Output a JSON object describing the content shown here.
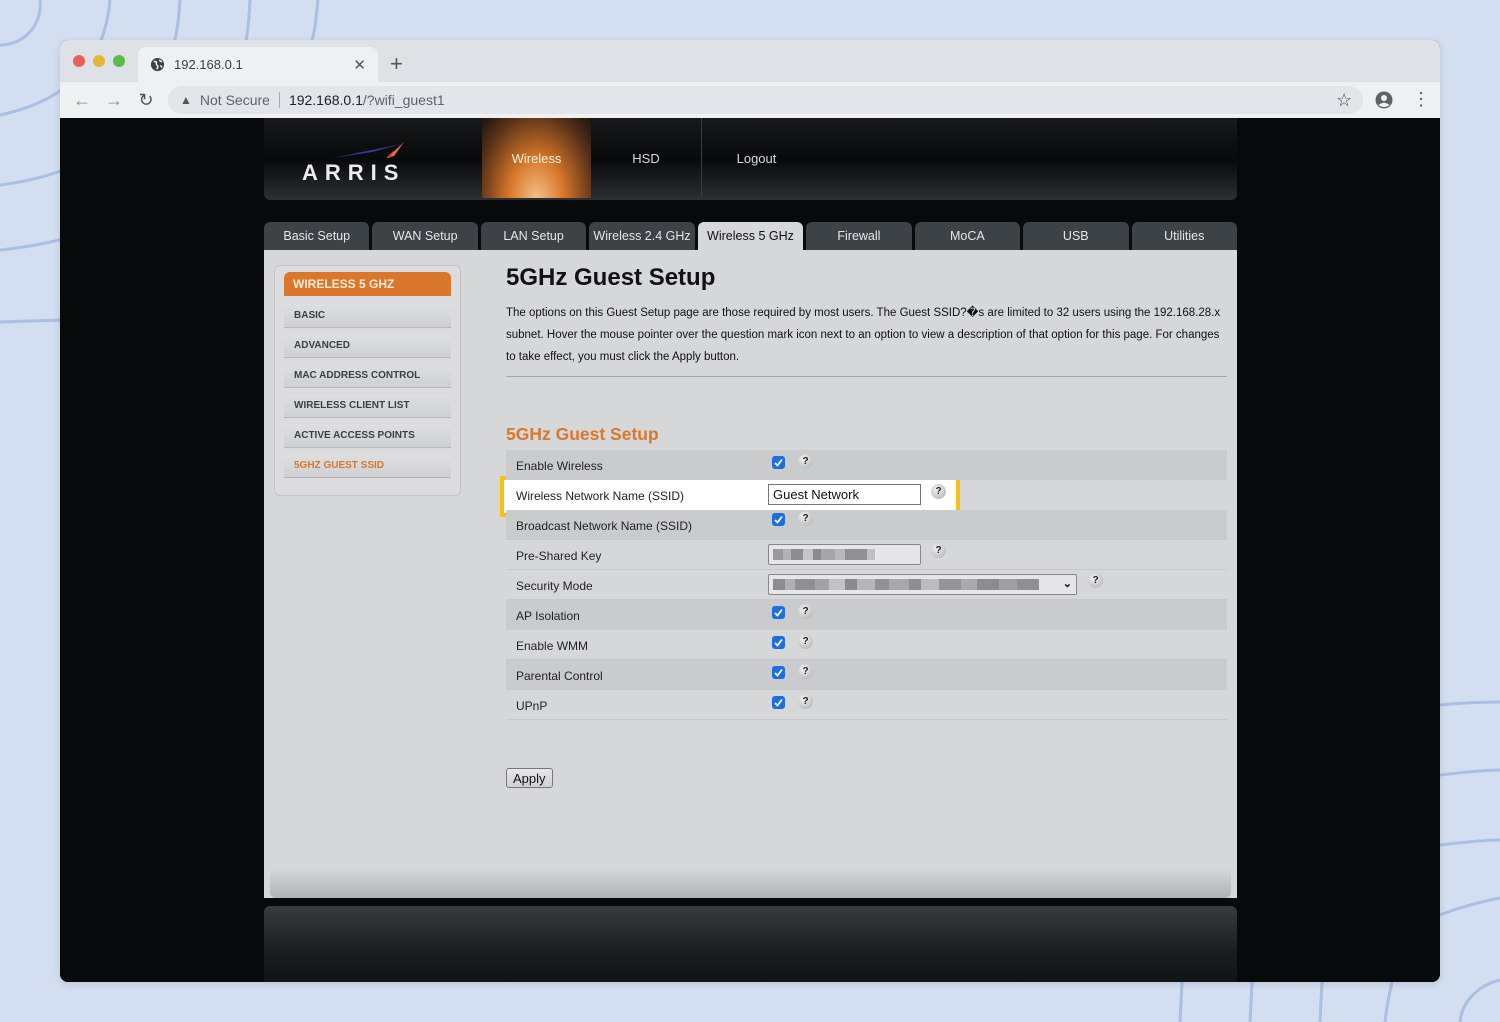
{
  "browser": {
    "tab_title": "192.168.0.1",
    "security_label": "Not Secure",
    "url_host": "192.168.0.1",
    "url_path": "/?wifi_guest1"
  },
  "brand": {
    "logo_text": "ARRIS",
    "accent": "#d9772d"
  },
  "top_nav": [
    {
      "label": "Wireless",
      "active": true
    },
    {
      "label": "HSD",
      "active": false
    },
    {
      "label": "Logout",
      "active": false
    }
  ],
  "tabs": [
    {
      "label": "Basic Setup",
      "active": false
    },
    {
      "label": "WAN Setup",
      "active": false
    },
    {
      "label": "LAN Setup",
      "active": false
    },
    {
      "label": "Wireless 2.4 GHz",
      "active": false
    },
    {
      "label": "Wireless 5 GHz",
      "active": true
    },
    {
      "label": "Firewall",
      "active": false
    },
    {
      "label": "MoCA",
      "active": false
    },
    {
      "label": "USB",
      "active": false
    },
    {
      "label": "Utilities",
      "active": false
    }
  ],
  "sidebar": {
    "heading": "WIRELESS 5 GHZ",
    "items": [
      {
        "label": "BASIC",
        "active": false
      },
      {
        "label": "ADVANCED",
        "active": false
      },
      {
        "label": "MAC ADDRESS CONTROL",
        "active": false
      },
      {
        "label": "WIRELESS CLIENT LIST",
        "active": false
      },
      {
        "label": "ACTIVE ACCESS POINTS",
        "active": false
      },
      {
        "label": "5GHZ GUEST SSID",
        "active": true
      }
    ]
  },
  "main": {
    "title": "5GHz Guest Setup",
    "intro": "The options on this Guest Setup page are those required by most users. The Guest SSID?�s are limited to 32 users using the 192.168.28.x subnet. Hover the mouse pointer over the question mark icon next to an option to view a description of that option for this page. For changes to take effect, you must click the Apply button.",
    "section_title": "5GHz Guest Setup",
    "fields": {
      "enable_wireless": {
        "label": "Enable Wireless",
        "checked": true
      },
      "ssid": {
        "label": "Wireless Network Name (SSID)",
        "value": "Guest Network"
      },
      "broadcast_ssid": {
        "label": "Broadcast Network Name (SSID)",
        "checked": true
      },
      "psk": {
        "label": "Pre-Shared Key",
        "value": "[redacted]"
      },
      "security_mode": {
        "label": "Security Mode",
        "value": "[redacted]"
      },
      "ap_isolation": {
        "label": "AP Isolation",
        "checked": true
      },
      "enable_wmm": {
        "label": "Enable WMM",
        "checked": true
      },
      "parental_control": {
        "label": "Parental Control",
        "checked": true
      },
      "upnp": {
        "label": "UPnP",
        "checked": true
      }
    },
    "help_glyph": "?",
    "apply_label": "Apply"
  }
}
